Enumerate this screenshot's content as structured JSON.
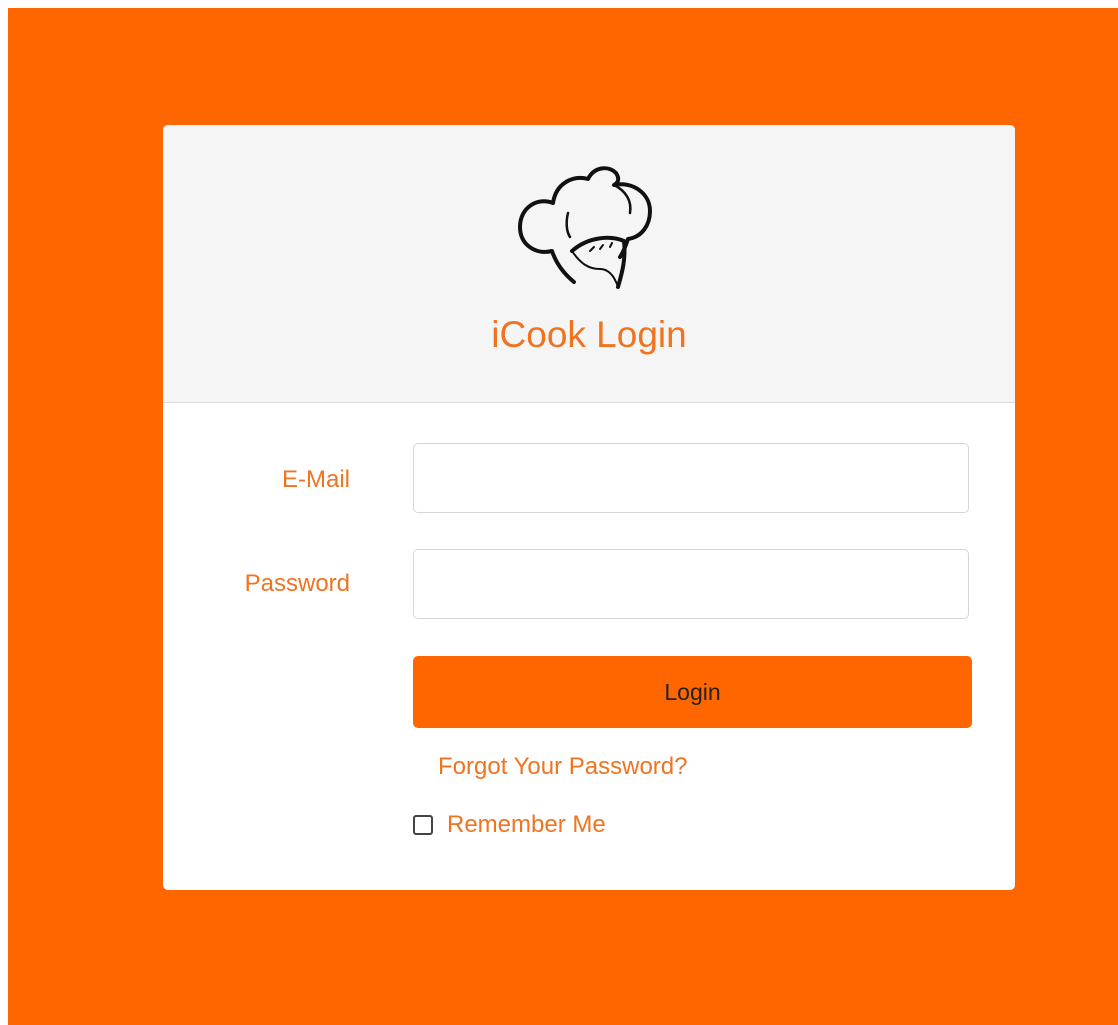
{
  "page": {
    "background_color": "#ff6600",
    "accent_color": "#f0731f"
  },
  "card": {
    "logo_icon": "chef-hat-icon",
    "title": "iCook Login"
  },
  "form": {
    "email_label": "E-Mail",
    "email_value": "",
    "password_label": "Password",
    "password_value": "",
    "login_label": "Login",
    "forgot_label": "Forgot Your Password?",
    "remember_label": "Remember Me",
    "remember_checked": false
  }
}
